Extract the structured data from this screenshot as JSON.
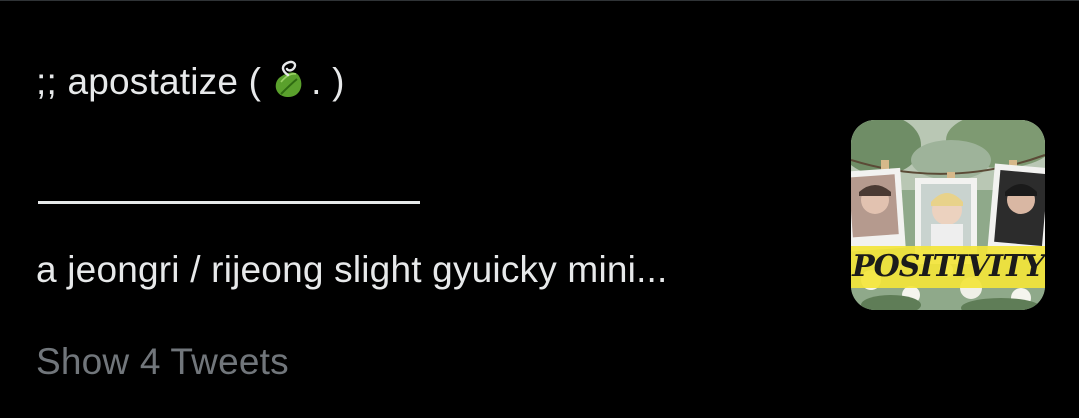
{
  "tweet": {
    "title_prefix": ";; apostatize (",
    "title_suffix": ". )",
    "title_icon": "leaf-icon",
    "body_text": "a jeongri / rijeong slight gyuicky mini...",
    "show_more_label": "Show 4 Tweets",
    "thumbnail_text": "POSITIVITY",
    "thumbnail_icon": "collage-photo-thumbnail"
  },
  "colors": {
    "background": "#000000",
    "primary_text": "#e7e9ea",
    "secondary_text": "#71767b",
    "divider": "#2f3336",
    "leaf_green": "#5aa02c",
    "thumb_yellow": "#f3e53a"
  }
}
